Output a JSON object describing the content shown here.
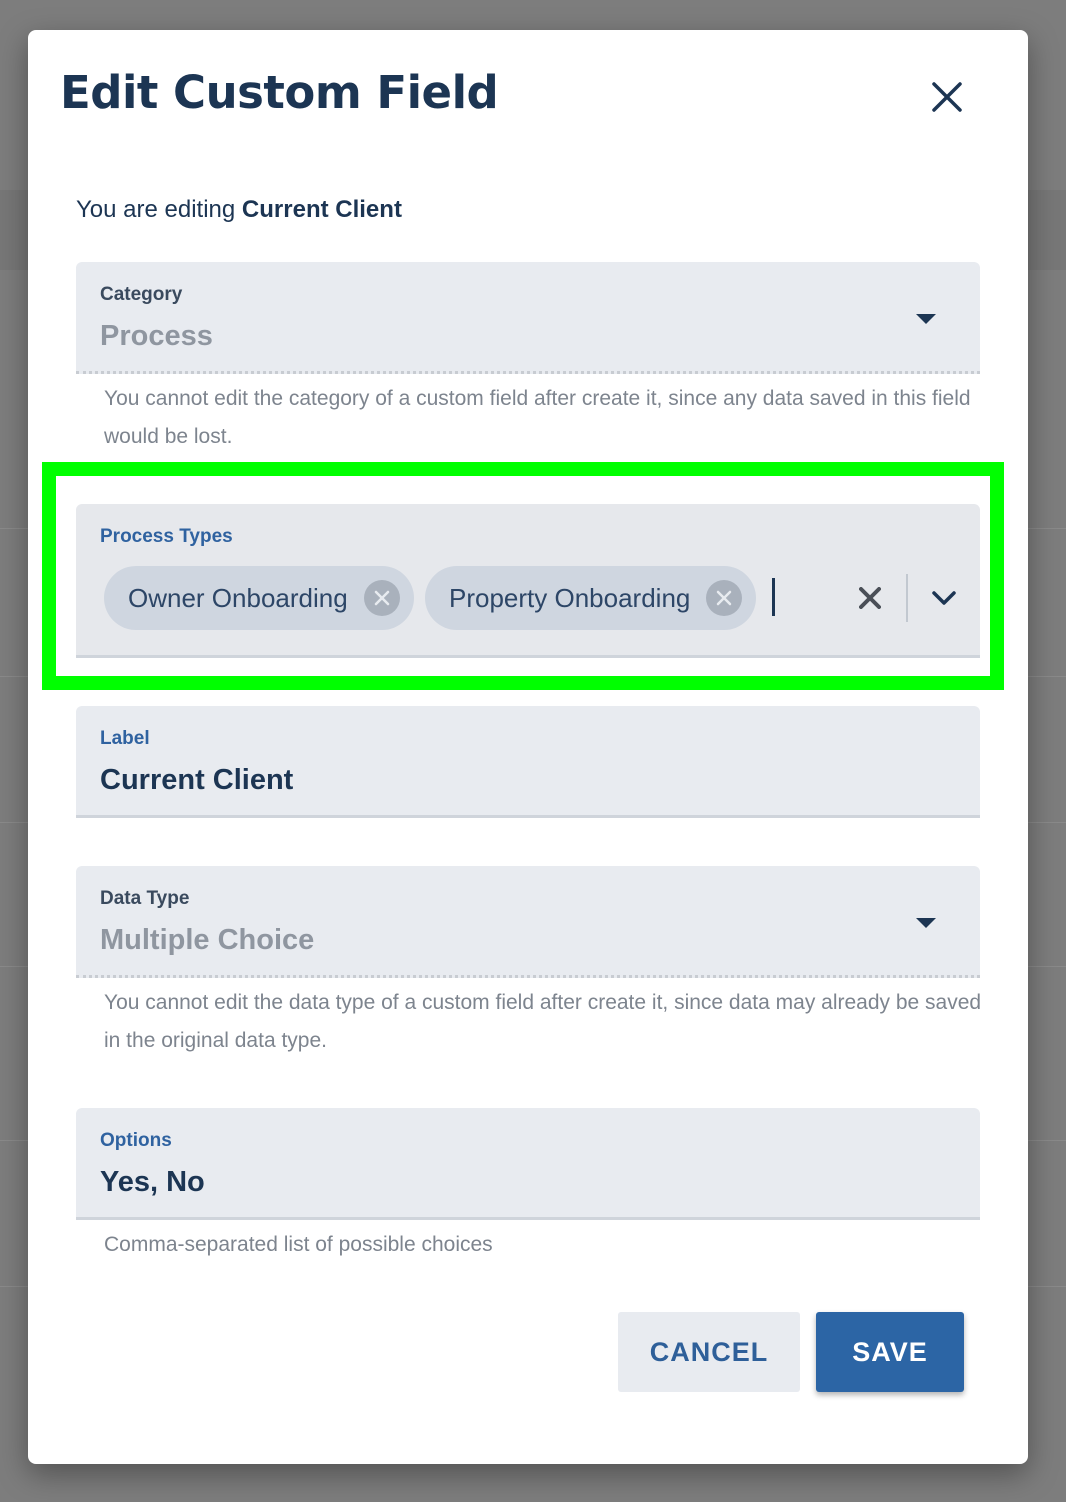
{
  "dialog": {
    "title": "Edit Custom Field",
    "close_icon": "close-icon",
    "editing_prefix": "You are editing ",
    "editing_target": "Current Client"
  },
  "category": {
    "label": "Category",
    "value": "Process",
    "helper": "You cannot edit the category of a custom field after create it, since any data saved in this field would be lost."
  },
  "process_types": {
    "label": "Process Types",
    "chips": [
      {
        "label": "Owner Onboarding"
      },
      {
        "label": "Property Onboarding"
      }
    ]
  },
  "label_field": {
    "label": "Label",
    "value": "Current Client"
  },
  "data_type": {
    "label": "Data Type",
    "value": "Multiple Choice",
    "helper": "You cannot edit the data type of a custom field after create it, since data may already be saved in the original data type."
  },
  "options": {
    "label": "Options",
    "value": "Yes, No",
    "helper": "Comma-separated list of possible choices"
  },
  "actions": {
    "cancel_label": "CANCEL",
    "save_label": "SAVE"
  },
  "colors": {
    "highlight": "#00ff00",
    "primary": "#2c65a5",
    "title": "#1c3553"
  }
}
